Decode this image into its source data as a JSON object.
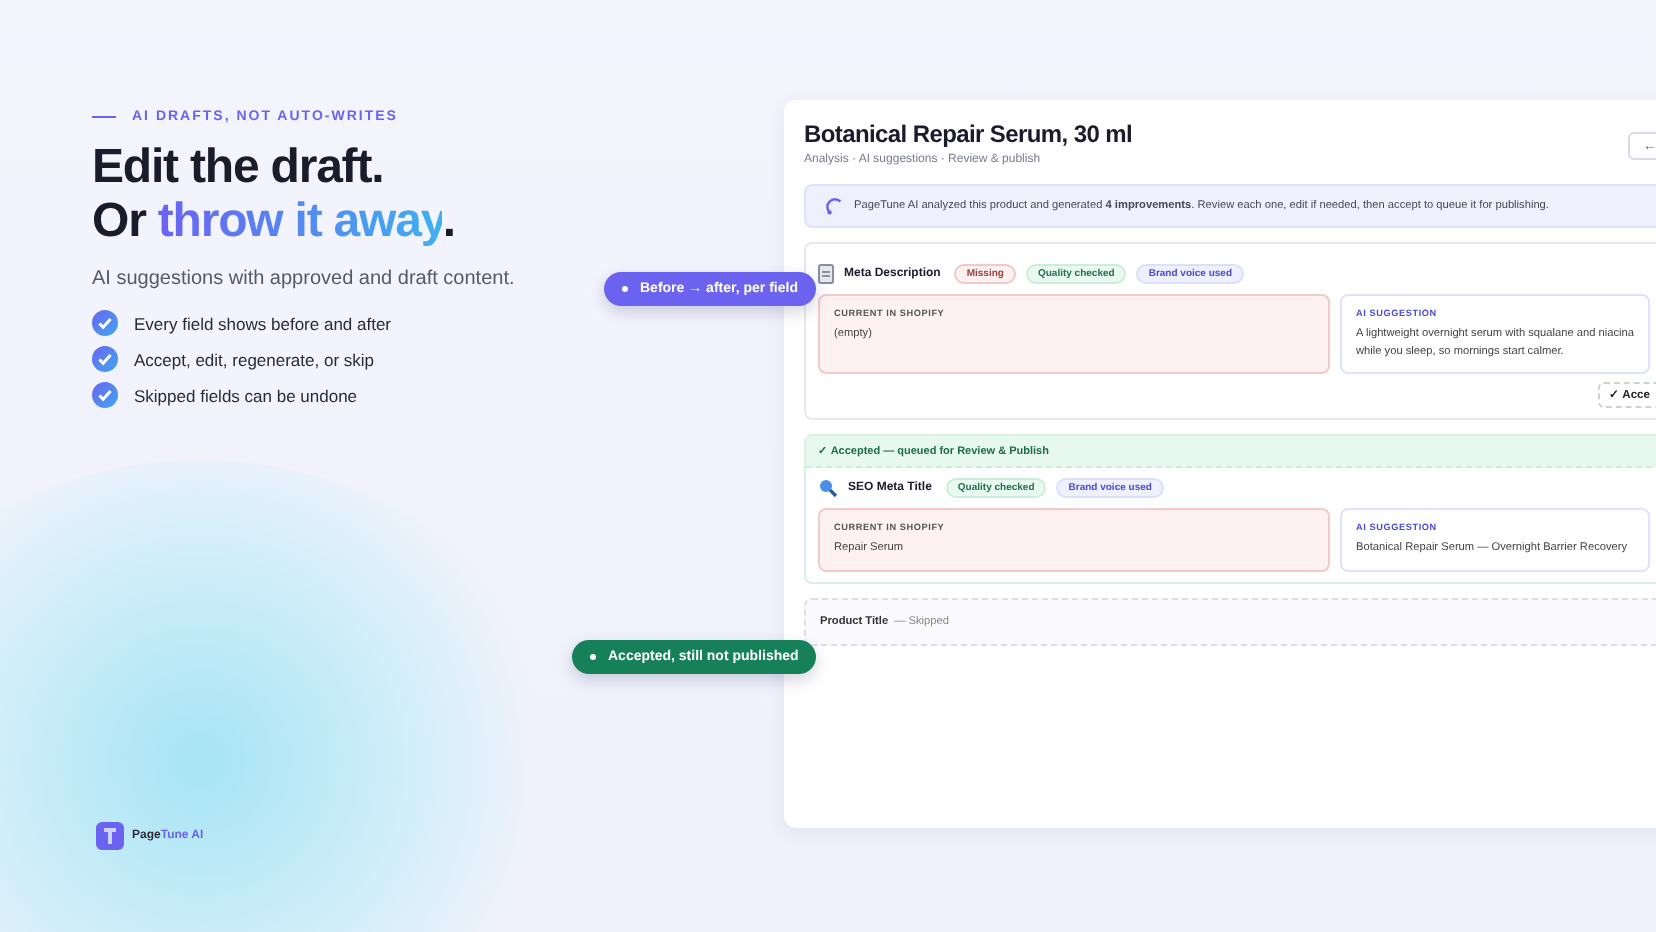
{
  "hero": {
    "eyebrow": "AI DRAFTS, NOT AUTO-WRITES",
    "headline_line1": "Edit the draft.",
    "headline_plain": "Or ",
    "headline_accent": "throw it away",
    "headline_end": ".",
    "subtitle": "AI suggestions with approved and draft content.",
    "bullets": [
      "Every field shows before and after",
      "Accept, edit, regenerate, or skip",
      "Skipped fields can be undone"
    ]
  },
  "callouts": [
    {
      "kind": "info",
      "label": "Before → after, per field"
    },
    {
      "kind": "success",
      "label": "Accepted, still not published"
    }
  ],
  "logo": {
    "name_plain": "Page",
    "name_accent": "Tune AI"
  },
  "panel": {
    "title": "Botanical Repair Serum, 30 ml",
    "breadcrumb": "Analysis · AI suggestions · Review & publish",
    "back_button": "←",
    "notice": "PageTune AI analyzed this product and generated **4 improvements**. Review each one, edit if needed, then accept to queue it for publishing.",
    "fields": [
      {
        "kind": "open",
        "title": "Meta Description",
        "badges": [
          {
            "kind": "missing",
            "label": "Missing"
          },
          {
            "kind": "quality",
            "label": "Quality checked"
          },
          {
            "kind": "brand",
            "label": "Brand voice used"
          }
        ],
        "current_label": "CURRENT IN SHOPIFY",
        "current_value": "(empty)",
        "suggestion_label": "AI SUGGESTION",
        "suggestion_lines": [
          "A lightweight overnight serum with squalane and niacina",
          "while you sleep, so mornings start calmer."
        ],
        "action": "✓ Acce"
      },
      {
        "kind": "accepted",
        "banner": "✓ Accepted — queued for Review & Publish",
        "title": "SEO Meta Title",
        "badges": [
          {
            "kind": "quality",
            "label": "Quality checked"
          },
          {
            "kind": "brand",
            "label": "Brand voice used"
          }
        ],
        "current_label": "CURRENT IN SHOPIFY",
        "current_value": "Repair Serum",
        "suggestion_label": "AI SUGGESTION",
        "suggestion_lines": [
          "Botanical Repair Serum — Overnight Barrier Recovery"
        ]
      },
      {
        "kind": "skipped",
        "title": "Product Title",
        "status": "— Skipped"
      }
    ]
  }
}
